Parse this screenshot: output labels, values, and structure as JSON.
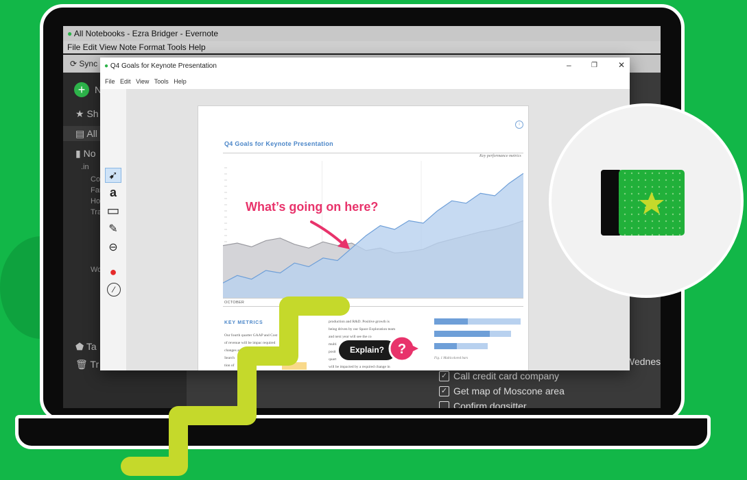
{
  "evernote": {
    "window_title": "All Notebooks - Ezra Bridger - Evernote",
    "menu": "File  Edit  View  Note  Format  Tools  Help",
    "sync_label": "Sync",
    "sidebar": {
      "new_label": "N",
      "items": [
        "Sh",
        "All",
        "No",
        "Ta",
        "Tr"
      ],
      "sub_items": [
        ".in",
        "Co",
        "Far",
        "Ho",
        "Tra",
        "Wo"
      ]
    },
    "weekday_fragment": "Wednesd",
    "checklist": [
      {
        "label": "Call credit card company",
        "checked": true
      },
      {
        "label": "Get map of Moscone area",
        "checked": true
      },
      {
        "label": "Confirm dogsitter",
        "checked": false
      }
    ]
  },
  "doc_window": {
    "title": "Q4 Goals for Keynote Presentation",
    "minimize": "–",
    "restore": "❐",
    "close": "✕",
    "menu": [
      "File",
      "Edit",
      "View",
      "Tools",
      "Help"
    ],
    "tools": [
      {
        "name": "pointer",
        "glyph": "➹"
      },
      {
        "name": "text",
        "glyph": "a"
      },
      {
        "name": "rectangle",
        "glyph": "▭"
      },
      {
        "name": "highlighter",
        "glyph": "✎"
      },
      {
        "name": "stamp",
        "glyph": "⊖"
      },
      {
        "name": "color",
        "glyph": "●"
      },
      {
        "name": "line-width",
        "glyph": "⁄"
      }
    ]
  },
  "document": {
    "title": "Q4 Goals for Keynote Presentation",
    "subtitle": "Key performance metrics",
    "month_label": "OCTOBER",
    "section_heading": "KEY METRICS",
    "col1_text": [
      "Our fourth quarter GAAP          and Cost",
      "of revenue will be impac          required",
      "changes and          ated to",
      "                                  Search",
      "                                  tion of"
    ],
    "col2_text": [
      "production and R&D. Positive growth is",
      "being driven by our Space Exploration team",
      "and next year will see the co",
      "multi",
      "posit",
      "quart",
      "will be impacted by a required change in"
    ],
    "figure_caption": "Fig. 1   Multicolored bars",
    "annotation": "What’s going on here?"
  },
  "chart_data": {
    "type": "area",
    "series": [
      {
        "values": [
          42,
          44,
          41,
          46,
          48,
          43,
          40,
          45,
          42,
          44,
          38,
          40,
          36,
          37,
          39,
          44,
          47,
          50,
          53,
          55,
          58,
          62
        ]
      },
      {
        "values": [
          12,
          18,
          15,
          22,
          20,
          28,
          25,
          32,
          30,
          40,
          50,
          58,
          55,
          62,
          60,
          70,
          78,
          76,
          84,
          82,
          92,
          100
        ]
      }
    ],
    "ylim": [
      0,
      110
    ],
    "grid": true
  },
  "mini_bars": [
    {
      "dark": 0.38,
      "light": 0.97
    },
    {
      "dark": 0.62,
      "light": 0.86
    },
    {
      "dark": 0.25,
      "light": 0.6
    }
  ],
  "overlay": {
    "explain_label": "Explain?",
    "question_mark": "?"
  },
  "colors": {
    "background": "#12b748",
    "brand_green": "#2db34a",
    "annotation": "#e8336b",
    "doc_blue": "#4b86c8",
    "zigzag": "#c5d92b"
  }
}
